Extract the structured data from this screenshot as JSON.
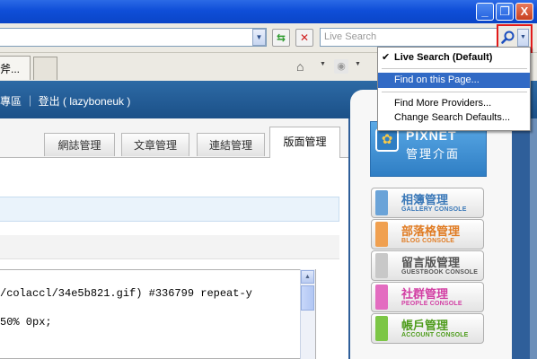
{
  "titlebar": {
    "minimize_glyph": "_",
    "maximize_glyph": "❐",
    "close_glyph": "X"
  },
  "toolbar": {
    "search_placeholder": "Live Search",
    "refresh_glyph": "⇆",
    "stop_glyph": "✕"
  },
  "tabs": [
    {
      "label": "斧..."
    },
    {
      "label": ""
    }
  ],
  "blog_header": {
    "text": "專區 ｜ 登出 ( lazyboneuk )"
  },
  "content_tabs": [
    {
      "label": "網誌管理"
    },
    {
      "label": "文章管理"
    },
    {
      "label": "連結管理"
    },
    {
      "label": "版面管理",
      "active": true
    }
  ],
  "code_editor": {
    "lines": [
      "/colaccl/34e5b821.gif) #336799 repeat-y",
      "",
      "50% 0px;"
    ]
  },
  "console": {
    "logo_title": "PIXNET",
    "logo_subtitle": "管理介面",
    "buttons": [
      {
        "zh": "相簿管理",
        "en": "GALLERY CONSOLE",
        "color": "#6aa3d8"
      },
      {
        "zh": "部落格管理",
        "en": "BLOG CONSOLE",
        "color": "#f0a050"
      },
      {
        "zh": "留言版管理",
        "en": "GUESTBOOK CONSOLE",
        "color": "#8c8c8c"
      },
      {
        "zh": "社群管理",
        "en": "PEOPLE CONSOLE",
        "color": "#e36cc0"
      },
      {
        "zh": "帳戶管理",
        "en": "ACCOUNT CONSOLE",
        "color": "#7cc646"
      }
    ]
  },
  "search_menu": {
    "default_label": "Live Search (Default)",
    "find_label": "Find on this Page...",
    "more_label": "Find More Providers...",
    "change_label": "Change Search Defaults..."
  }
}
